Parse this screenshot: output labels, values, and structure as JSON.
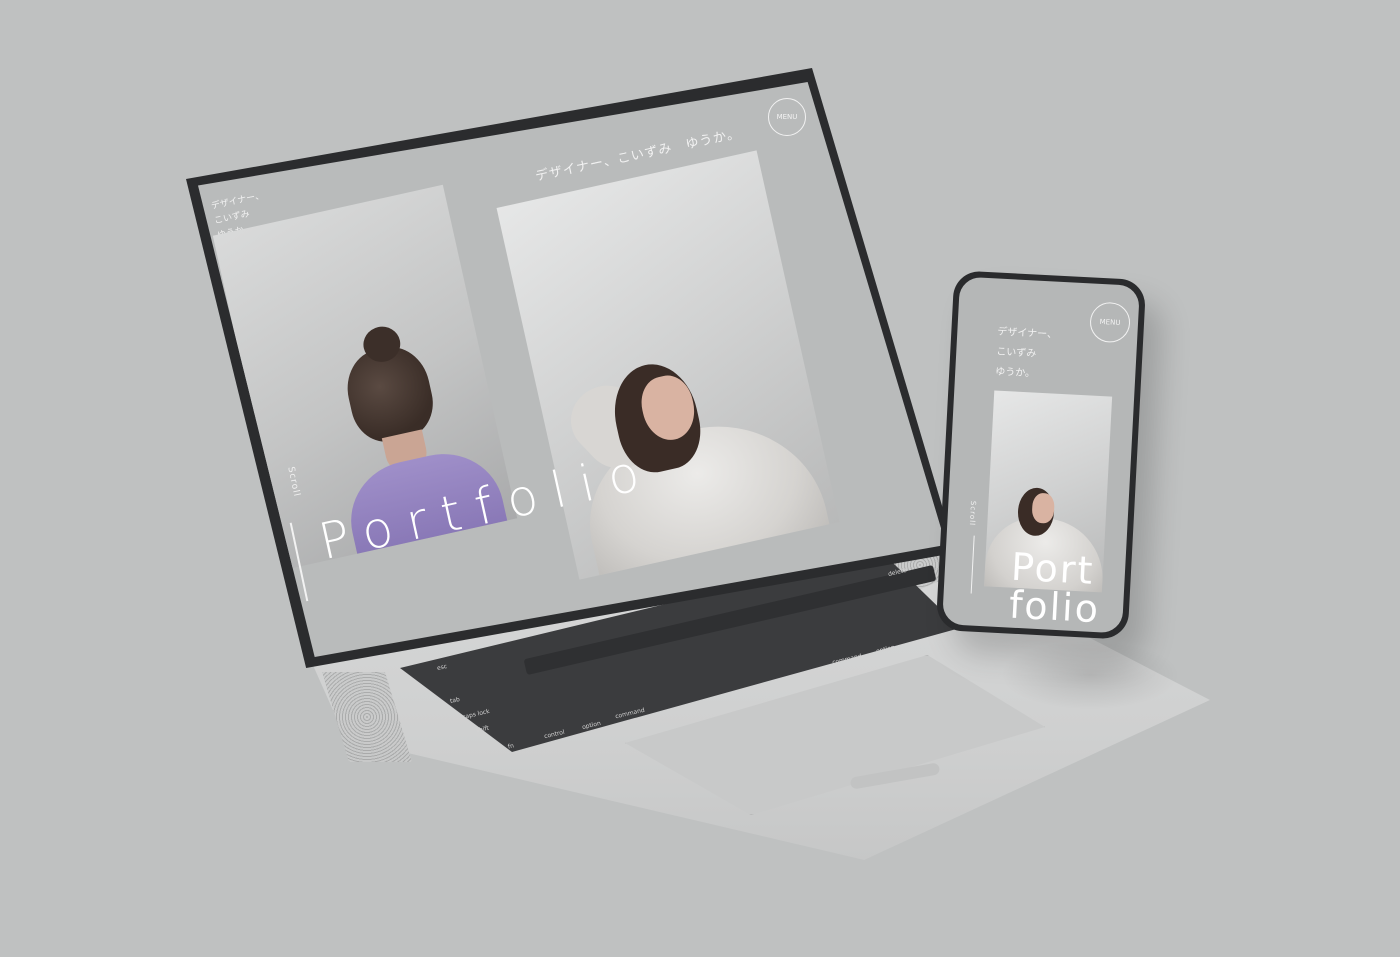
{
  "laptop": {
    "site_title": "デザイナー、こいずみ　ゆうか。",
    "menu_label": "MENU",
    "side_text": "デザイナー、\nこいずみ\nゆうか。",
    "scroll_label": "Scroll",
    "hero_word": "Portfolio",
    "keys": {
      "esc": "esc",
      "tab": "tab",
      "caps_lock": "caps lock",
      "shift": "shift",
      "control": "control",
      "option": "option",
      "command": "command",
      "fn": "fn",
      "delete": "delete",
      "return": "return",
      "option_right": "option",
      "command_right": "command"
    }
  },
  "phone": {
    "menu_label": "MENU",
    "side_text": "デザイナー、\nこいずみ\nゆうか。",
    "scroll_label": "Scroll",
    "hero_word": "Port\nfolio"
  }
}
